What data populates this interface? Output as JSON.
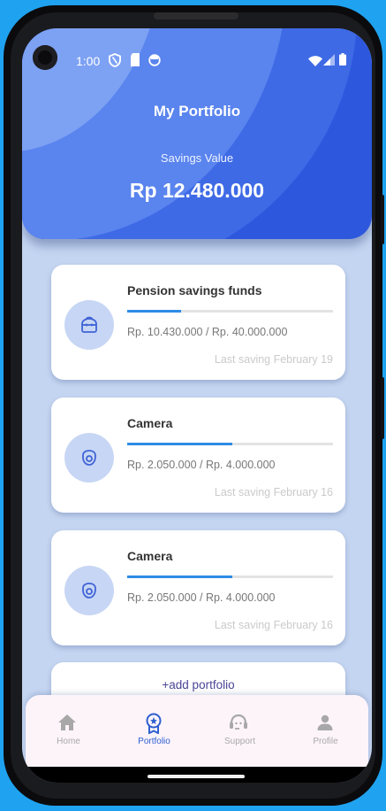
{
  "status_bar": {
    "time": "1:00"
  },
  "header": {
    "title": "My Portfolio",
    "subtitle": "Savings Value",
    "amount": "Rp 12.480.000"
  },
  "portfolios": [
    {
      "name": "Pension savings funds",
      "values": "Rp. 10.430.000 / Rp. 40.000.000",
      "last_saving": "Last saving February 19",
      "progress": 0.26,
      "icon": "piggy-bank-icon"
    },
    {
      "name": "Camera",
      "values": "Rp. 2.050.000 / Rp. 4.000.000",
      "last_saving": "Last saving February 16",
      "progress": 0.51,
      "icon": "camera-icon"
    },
    {
      "name": "Camera",
      "values": "Rp. 2.050.000 / Rp. 4.000.000",
      "last_saving": "Last saving February 16",
      "progress": 0.51,
      "icon": "camera-icon"
    }
  ],
  "add_portfolio": {
    "plus": "+",
    "label": "add portfolio"
  },
  "nav": {
    "items": [
      {
        "label": "Home",
        "icon": "home-icon",
        "active": false
      },
      {
        "label": "Portfolio",
        "icon": "award-icon",
        "active": true
      },
      {
        "label": "Support",
        "icon": "support-icon",
        "active": false
      },
      {
        "label": "Profile",
        "icon": "person-icon",
        "active": false
      }
    ]
  },
  "colors": {
    "accent": "#2d58de",
    "progress": "#2e8ce6",
    "background": "#c4d5f1",
    "active_nav": "#2e5fcf"
  }
}
